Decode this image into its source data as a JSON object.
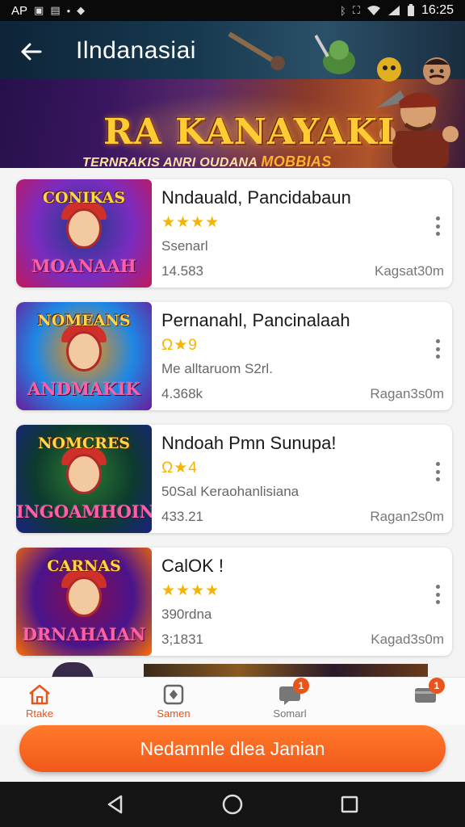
{
  "status_bar": {
    "left_text": "ΑΡ",
    "time": "16:25"
  },
  "header": {
    "title": "Ilndanasiai",
    "banner_title": "RA KANAYAKI",
    "banner_subtitle": "TERNRAKIS ANRI OUDANA",
    "banner_subtitle_accent": "MOBBIAS"
  },
  "games": [
    {
      "title": "Nndauald, Pancidabaun",
      "rating_display": "★★★★",
      "meta": "Ssenarl",
      "count": "14.583",
      "size": "Kagsat30m",
      "thumb_top": "CONIKAS",
      "thumb_bottom": "MOANAAH",
      "colors": [
        "#7b2cbf",
        "#c2185b",
        "#1e3a8a"
      ]
    },
    {
      "title": "Pernanahl, Pancinalaah",
      "rating_display": "Ω★9",
      "meta": "Me alltaruom S2rl.",
      "count": "4.368k",
      "size": "Ragan3s0m",
      "thumb_top": "NOMEANS",
      "thumb_bottom": "ANDMAKIK",
      "colors": [
        "#1e88e5",
        "#6a1b9a",
        "#ff8f00"
      ]
    },
    {
      "title": "Nndoah Pmn Sunupa!",
      "rating_display": "Ω★4",
      "meta": "50Sal Keraohanlisiana",
      "count": "433.21",
      "size": "Ragan2s0m",
      "thumb_top": "NOMCRES",
      "thumb_bottom": "INGOAMHOIN",
      "colors": [
        "#0d3b2e",
        "#1a237e",
        "#2e7d32"
      ]
    },
    {
      "title": "CalOK !",
      "rating_display": "★★★★",
      "meta": "390rdna",
      "count": "3;1831",
      "size": "Kagad3s0m",
      "thumb_top": "CARNAS",
      "thumb_bottom": "DRNAHAIAN",
      "colors": [
        "#4a148c",
        "#ff6f00",
        "#880e4f"
      ]
    }
  ],
  "bottom_nav": [
    {
      "label": "Rtake",
      "icon": "home-icon",
      "badge": ""
    },
    {
      "label": "Samen",
      "icon": "games-icon",
      "badge": ""
    },
    {
      "label": "Somarl",
      "icon": "chat-icon",
      "badge": "1"
    },
    {
      "label": "",
      "icon": "wallet-icon",
      "badge": "1"
    }
  ],
  "cta": {
    "label": "Nedamnle dlea Janian"
  },
  "colors": {
    "accent": "#f2581a",
    "star": "#f4b400"
  }
}
